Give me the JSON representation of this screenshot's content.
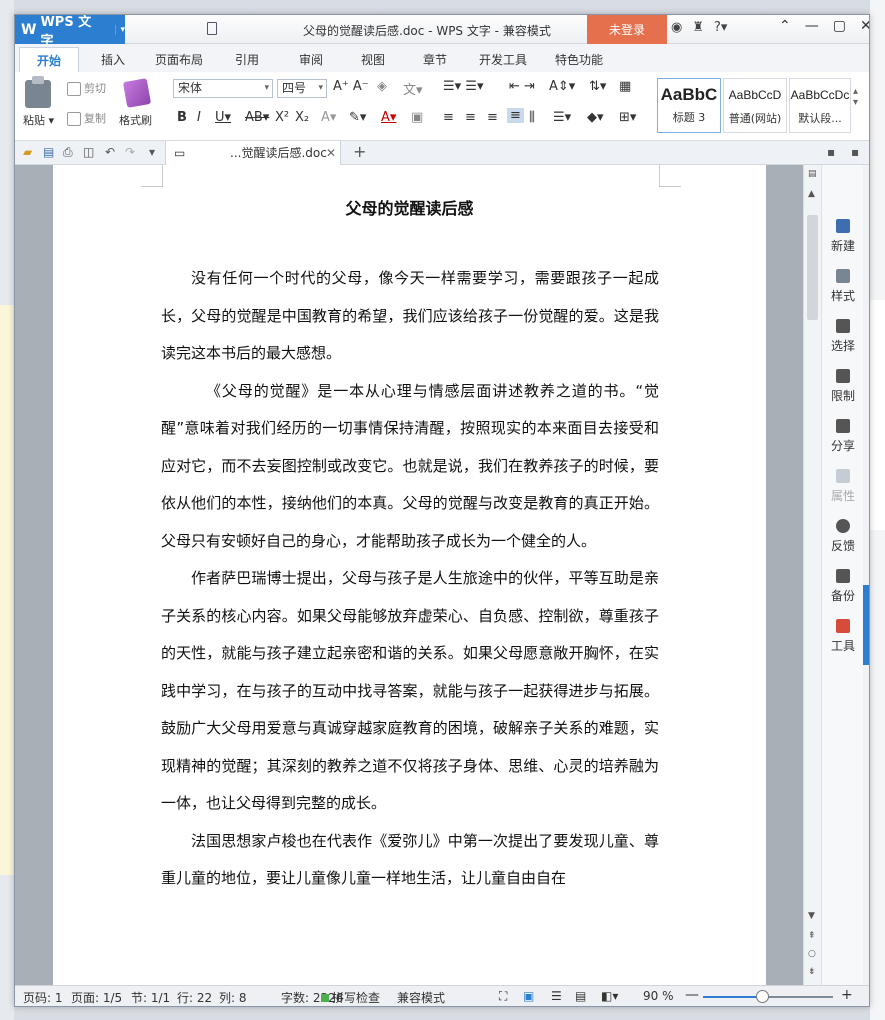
{
  "window": {
    "app_name": "WPS 文字",
    "title": "父母的觉醒读后感.doc - WPS 文字 - 兼容模式",
    "login_label": "未登录"
  },
  "tabs": [
    "开始",
    "插入",
    "页面布局",
    "引用",
    "审阅",
    "视图",
    "章节",
    "开发工具",
    "特色功能"
  ],
  "ribbon": {
    "paste_label": "粘贴",
    "cut_label": "剪切",
    "copy_label": "复制",
    "format_painter_label": "格式刷",
    "font_name": "宋体",
    "font_size": "四号",
    "styles": [
      {
        "sample": "AaBbC",
        "label": "标题 3"
      },
      {
        "sample": "AaBbCcD",
        "label": "普通(网站)"
      },
      {
        "sample": "AaBbCcDc",
        "label": "默认段..."
      }
    ]
  },
  "doc_tab": {
    "label": "...觉醒读后感.doc"
  },
  "document": {
    "title": "父母的觉醒读后感",
    "paragraphs": [
      "没有任何一个时代的父母，像今天一样需要学习，需要跟孩子一起成长，父母的觉醒是中国教育的希望，我们应该给孩子一份觉醒的爱。这是我读完这本书后的最大感想。",
      "《父母的觉醒》是一本从心理与情感层面讲述教养之道的书。“觉醒”意味着对我们经历的一切事情保持清醒，按照现实的本来面目去接受和应对它，而不去妄图控制或改变它。也就是说，我们在教养孩子的时候，要依从他们的本性，接纳他们的本真。父母的觉醒与改变是教育的真正开始。父母只有安顿好自己的身心，才能帮助孩子成长为一个健全的人。",
      "作者萨巴瑞博士提出，父母与孩子是人生旅途中的伙伴，平等互助是亲子关系的核心内容。如果父母能够放弃虚荣心、自负感、控制欲，尊重孩子的天性，就能与孩子建立起亲密和谐的关系。如果父母愿意敞开胸怀，在实践中学习，在与孩子的互动中找寻答案，就能与孩子一起获得进步与拓展。鼓励广大父母用爱意与真诚穿越家庭教育的困境，破解亲子关系的难题，实现精神的觉醒；其深刻的教养之道不仅将孩子身体、思维、心灵的培养融为一体，也让父母得到完整的成长。",
      "法国思想家卢梭也在代表作《爱弥儿》中第一次提出了要发现儿童、尊重儿童的地位，要让儿童像儿童一样地生活，让儿童自由自在"
    ]
  },
  "taskpane": [
    "新建",
    "样式",
    "选择",
    "限制",
    "分享",
    "属性",
    "反馈",
    "备份",
    "工具"
  ],
  "status": {
    "page_num": "页码: 1",
    "pages": "页面: 1/5",
    "section": "节: 1/1",
    "row": "行: 22",
    "col": "列: 8",
    "word_count": "字数: 2326",
    "spell_check": "拼写检查",
    "compat_mode": "兼容模式",
    "zoom": "90 %",
    "zoom_level": 0.45
  },
  "colors": {
    "accent": "#2c7fd0",
    "login": "#e4704e"
  }
}
